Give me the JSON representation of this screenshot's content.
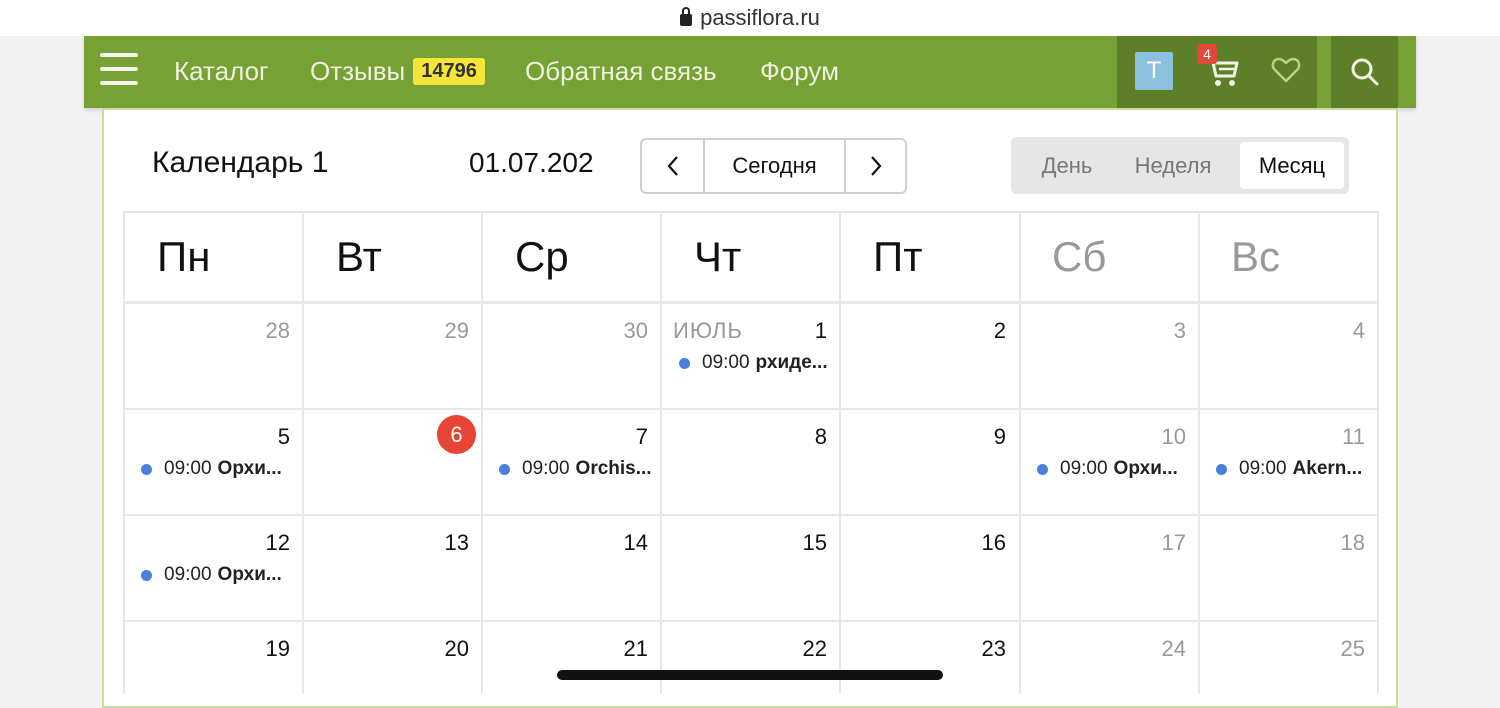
{
  "browser": {
    "url": "passiflora.ru"
  },
  "nav": {
    "menu_icon": "hamburger-icon",
    "links": [
      {
        "label": "Каталог"
      },
      {
        "label": "Отзывы",
        "badge": "14796"
      },
      {
        "label": "Обратная связь"
      },
      {
        "label": "Форум"
      }
    ],
    "avatar_letter": "Т",
    "cart_count": "4",
    "icons": {
      "cart": "cart-icon",
      "favorites": "heart-icon",
      "search": "search-icon"
    },
    "colors": {
      "bar": "#76a134",
      "bar_dark": "#5d7f27",
      "badge": "#f5e53a",
      "cart_badge": "#e14a3a"
    }
  },
  "calendar": {
    "title": "Календарь 1",
    "current_date": "01.07.202",
    "buttons": {
      "prev": "‹",
      "today": "Сегодня",
      "next": "›"
    },
    "views": [
      {
        "label": "День"
      },
      {
        "label": "Неделя"
      },
      {
        "label": "Месяц",
        "active": true
      }
    ],
    "weekdays": [
      "Пн",
      "Вт",
      "Ср",
      "Чт",
      "Пт",
      "Сб",
      "Вс"
    ],
    "month_label": "ИЮЛЬ",
    "weeks": [
      [
        "28",
        "29",
        "30",
        "1",
        "2",
        "3",
        "4"
      ],
      [
        "5",
        "6",
        "7",
        "8",
        "9",
        "10",
        "11"
      ],
      [
        "12",
        "13",
        "14",
        "15",
        "16",
        "17",
        "18"
      ],
      [
        "19",
        "20",
        "21",
        "22",
        "23",
        "24",
        "25"
      ]
    ],
    "today": "6",
    "events": [
      {
        "day": "1",
        "time": "09:00",
        "name": "рхиде..."
      },
      {
        "day": "5",
        "time": "09:00",
        "name": "Орхи..."
      },
      {
        "day": "7",
        "time": "09:00",
        "name": "Orchis..."
      },
      {
        "day": "10",
        "time": "09:00",
        "name": "Орхи..."
      },
      {
        "day": "11",
        "time": "09:00",
        "name": "Akern..."
      },
      {
        "day": "12",
        "time": "09:00",
        "name": "Орхи..."
      }
    ],
    "colors": {
      "today": "#e64535",
      "event_dot": "#4a7fdc",
      "weekend_text": "#999999",
      "other_month_text": "#999999"
    }
  }
}
